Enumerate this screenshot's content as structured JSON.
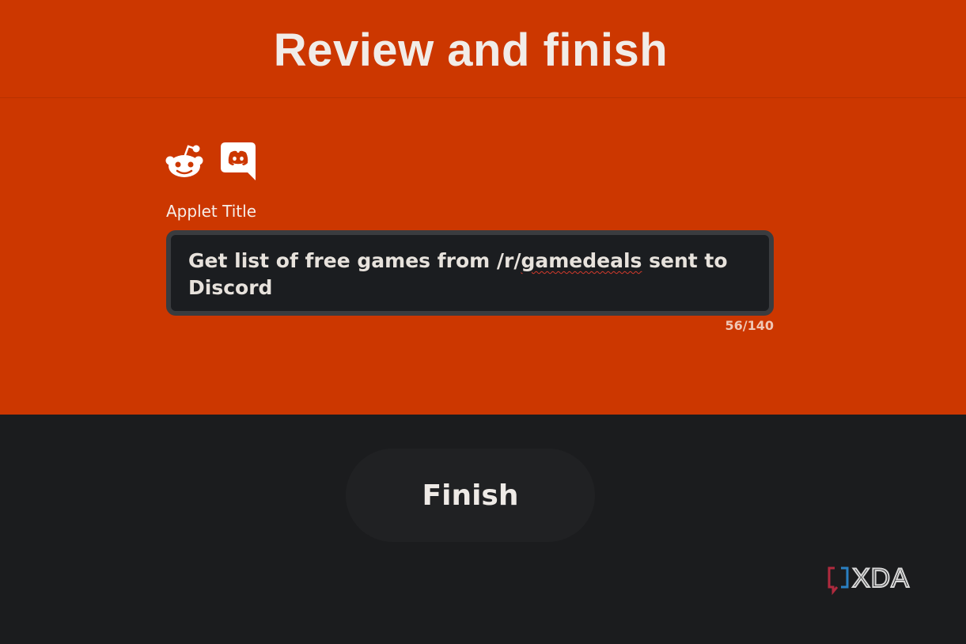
{
  "header": {
    "title": "Review and finish"
  },
  "services": {
    "trigger_icon": "reddit-icon",
    "action_icon": "discord-icon"
  },
  "form": {
    "label": "Applet Title",
    "title_value_before": "Get list of free games from /r/",
    "title_value_misspelled": "gamedeals",
    "title_value_after": " sent to Discord",
    "counter": "56/140"
  },
  "actions": {
    "finish_label": "Finish"
  },
  "watermark": {
    "text": "XDA",
    "icon": "xda-bracket-icon"
  },
  "colors": {
    "accent": "#cc3700",
    "background": "#1b1c1e",
    "input_bg": "#1b1d20",
    "input_border": "#3a3c3f"
  }
}
